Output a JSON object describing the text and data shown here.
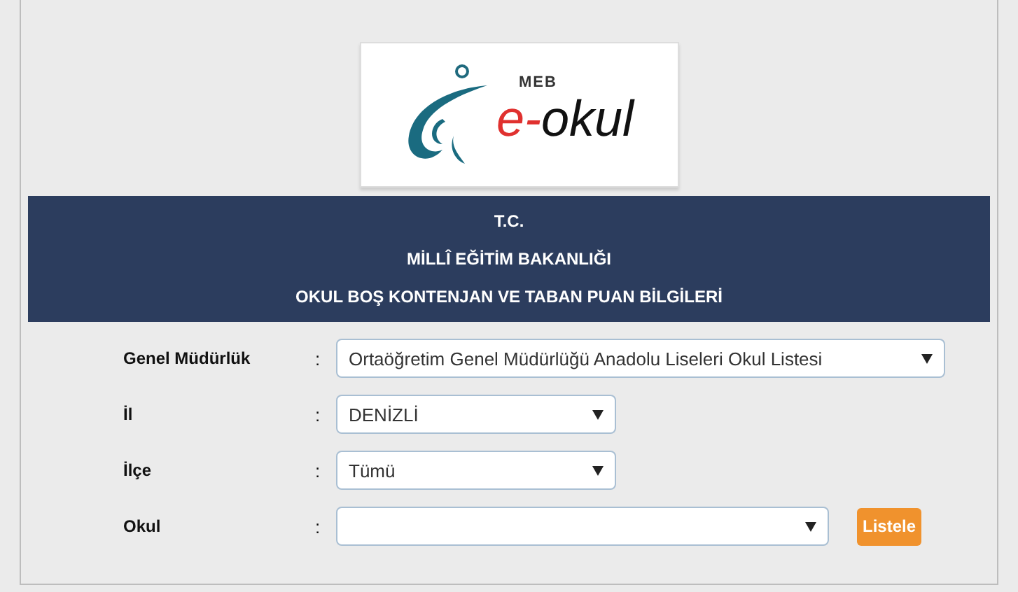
{
  "logo": {
    "brand": "MEB",
    "prefix": "e-",
    "name": "okul"
  },
  "header": {
    "lines": [
      "T.C.",
      "MİLLÎ EĞİTİM BAKANLIĞI",
      "OKUL BOŞ KONTENJAN VE TABAN PUAN BİLGİLERİ"
    ]
  },
  "form": {
    "rows": [
      {
        "label": "Genel Müdürlük",
        "separator": ":",
        "value": "Ortaöğretim Genel Müdürlüğü Anadolu Liseleri Okul Listesi"
      },
      {
        "label": "İl",
        "separator": ":",
        "value": "DENİZLİ"
      },
      {
        "label": "İlçe",
        "separator": ":",
        "value": "Tümü"
      },
      {
        "label": "Okul",
        "separator": ":",
        "value": "",
        "button": "Listele"
      }
    ]
  }
}
